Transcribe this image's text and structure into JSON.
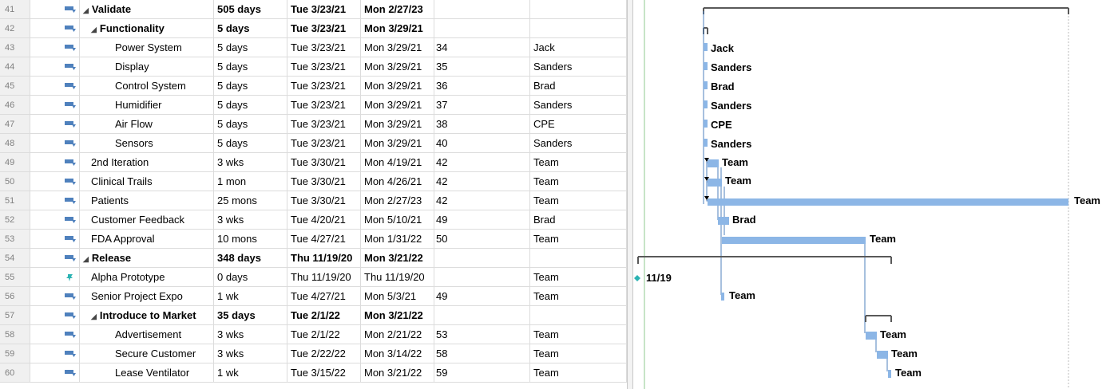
{
  "rows": [
    {
      "id": "41",
      "name": "Validate",
      "duration": "505 days",
      "start": "Tue 3/23/21",
      "finish": "Mon 2/27/23",
      "pred": "",
      "res": "",
      "level": 0,
      "summary": true,
      "mode": "auto"
    },
    {
      "id": "42",
      "name": "Functionality",
      "duration": "5 days",
      "start": "Tue 3/23/21",
      "finish": "Mon 3/29/21",
      "pred": "",
      "res": "",
      "level": 1,
      "summary": true,
      "mode": "auto"
    },
    {
      "id": "43",
      "name": "Power System",
      "duration": "5 days",
      "start": "Tue 3/23/21",
      "finish": "Mon 3/29/21",
      "pred": "34",
      "res": "Jack",
      "level": 2,
      "summary": false,
      "mode": "auto"
    },
    {
      "id": "44",
      "name": "Display",
      "duration": "5 days",
      "start": "Tue 3/23/21",
      "finish": "Mon 3/29/21",
      "pred": "35",
      "res": "Sanders",
      "level": 2,
      "summary": false,
      "mode": "auto"
    },
    {
      "id": "45",
      "name": "Control System",
      "duration": "5 days",
      "start": "Tue 3/23/21",
      "finish": "Mon 3/29/21",
      "pred": "36",
      "res": "Brad",
      "level": 2,
      "summary": false,
      "mode": "auto"
    },
    {
      "id": "46",
      "name": "Humidifier",
      "duration": "5 days",
      "start": "Tue 3/23/21",
      "finish": "Mon 3/29/21",
      "pred": "37",
      "res": "Sanders",
      "level": 2,
      "summary": false,
      "mode": "auto"
    },
    {
      "id": "47",
      "name": "Air Flow",
      "duration": "5 days",
      "start": "Tue 3/23/21",
      "finish": "Mon 3/29/21",
      "pred": "38",
      "res": "CPE",
      "level": 2,
      "summary": false,
      "mode": "auto"
    },
    {
      "id": "48",
      "name": "Sensors",
      "duration": "5 days",
      "start": "Tue 3/23/21",
      "finish": "Mon 3/29/21",
      "pred": "40",
      "res": "Sanders",
      "level": 2,
      "summary": false,
      "mode": "auto"
    },
    {
      "id": "49",
      "name": "2nd Iteration",
      "duration": "3 wks",
      "start": "Tue 3/30/21",
      "finish": "Mon 4/19/21",
      "pred": "42",
      "res": "Team",
      "level": 1,
      "summary": false,
      "mode": "auto"
    },
    {
      "id": "50",
      "name": "Clinical Trails",
      "duration": "1 mon",
      "start": "Tue 3/30/21",
      "finish": "Mon 4/26/21",
      "pred": "42",
      "res": "Team",
      "level": 1,
      "summary": false,
      "mode": "auto"
    },
    {
      "id": "51",
      "name": "Patients",
      "duration": "25 mons",
      "start": "Tue 3/30/21",
      "finish": "Mon 2/27/23",
      "pred": "42",
      "res": "Team",
      "level": 1,
      "summary": false,
      "mode": "auto"
    },
    {
      "id": "52",
      "name": "Customer Feedback",
      "duration": "3 wks",
      "start": "Tue 4/20/21",
      "finish": "Mon 5/10/21",
      "pred": "49",
      "res": "Brad",
      "level": 1,
      "summary": false,
      "mode": "auto"
    },
    {
      "id": "53",
      "name": "FDA Approval",
      "duration": "10 mons",
      "start": "Tue 4/27/21",
      "finish": "Mon 1/31/22",
      "pred": "50",
      "res": "Team",
      "level": 1,
      "summary": false,
      "mode": "auto"
    },
    {
      "id": "54",
      "name": "Release",
      "duration": "348 days",
      "start": "Thu 11/19/20",
      "finish": "Mon 3/21/22",
      "pred": "",
      "res": "",
      "level": 0,
      "summary": true,
      "mode": "auto"
    },
    {
      "id": "55",
      "name": "Alpha Prototype",
      "duration": "0 days",
      "start": "Thu 11/19/20",
      "finish": "Thu 11/19/20",
      "pred": "",
      "res": "Team",
      "level": 1,
      "summary": false,
      "mode": "manual"
    },
    {
      "id": "56",
      "name": "Senior Project Expo",
      "duration": "1 wk",
      "start": "Tue 4/27/21",
      "finish": "Mon 5/3/21",
      "pred": "49",
      "res": "Team",
      "level": 1,
      "summary": false,
      "mode": "auto"
    },
    {
      "id": "57",
      "name": "Introduce to Market",
      "duration": "35 days",
      "start": "Tue 2/1/22",
      "finish": "Mon 3/21/22",
      "pred": "",
      "res": "",
      "level": 1,
      "summary": true,
      "mode": "auto"
    },
    {
      "id": "58",
      "name": "Advertisement",
      "duration": "3 wks",
      "start": "Tue 2/1/22",
      "finish": "Mon 2/21/22",
      "pred": "53",
      "res": "Team",
      "level": 2,
      "summary": false,
      "mode": "auto"
    },
    {
      "id": "59",
      "name": "Secure Customer",
      "duration": "3 wks",
      "start": "Tue 2/22/22",
      "finish": "Mon 3/14/22",
      "pred": "58",
      "res": "Team",
      "level": 2,
      "summary": false,
      "mode": "auto"
    },
    {
      "id": "60",
      "name": "Lease Ventilator",
      "duration": "1 wk",
      "start": "Tue 3/15/22",
      "finish": "Mon 3/21/22",
      "pred": "59",
      "res": "Team",
      "level": 2,
      "summary": false,
      "mode": "auto"
    }
  ],
  "gantt": {
    "milestone_label": "11/19",
    "bar_labels": [
      "Jack",
      "Sanders",
      "Brad",
      "Sanders",
      "CPE",
      "Sanders",
      "Team",
      "Team",
      "Team",
      "Brad",
      "Team",
      "Team",
      "Team",
      "Team",
      "Team"
    ],
    "colors": {
      "bar": "#8cb6e6",
      "summary": "#595959",
      "link": "#4f81bd",
      "milestone": "#2bb3b3",
      "today": "#7fbf7f"
    }
  }
}
